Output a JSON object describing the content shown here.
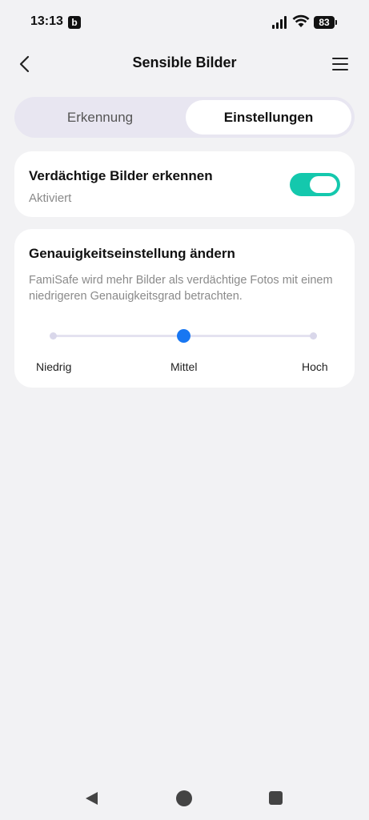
{
  "status_bar": {
    "time": "13:13",
    "app_badge": "b",
    "battery": "83"
  },
  "header": {
    "title": "Sensible Bilder"
  },
  "tabs": [
    {
      "label": "Erkennung",
      "active": false
    },
    {
      "label": "Einstellungen",
      "active": true
    }
  ],
  "detect_card": {
    "title": "Verdächtige Bilder erkennen",
    "status": "Aktiviert",
    "toggle_on": true
  },
  "accuracy_card": {
    "title": "Genauigkeitseinstellung ändern",
    "description": "FamiSafe wird mehr Bilder als verdächtige Fotos mit einem niedrigeren Genauigkeitsgrad betrachten.",
    "slider": {
      "options": [
        "Niedrig",
        "Mittel",
        "Hoch"
      ],
      "selected": "Mittel",
      "value_fraction": 0.5
    }
  },
  "colors": {
    "accent_toggle": "#14c8ad",
    "slider_thumb": "#1877f2",
    "tab_track": "#e8e6f1",
    "background": "#f2f2f4"
  },
  "icons": {
    "back": "chevron-left-icon",
    "menu": "hamburger-menu-icon",
    "nav_back": "triangle-back-icon",
    "nav_home": "circle-home-icon",
    "nav_recents": "square-recents-icon"
  }
}
